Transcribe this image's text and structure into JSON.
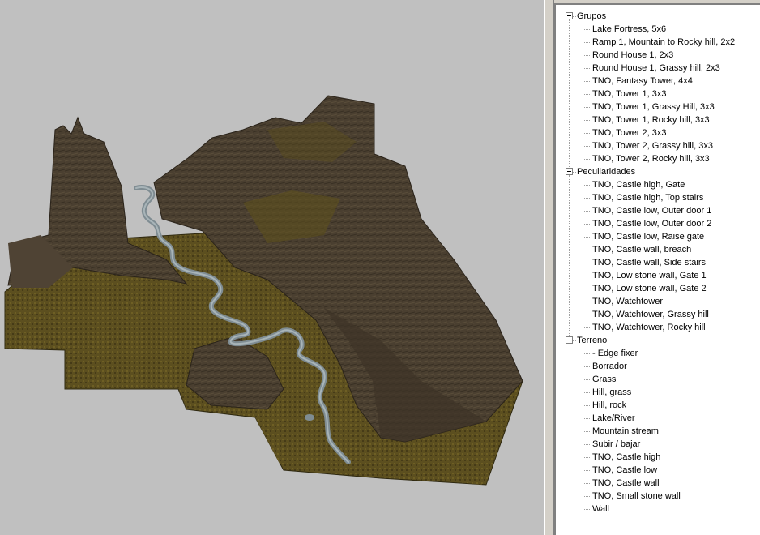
{
  "tree": {
    "groups": [
      {
        "label": "Grupos",
        "items": [
          "Lake Fortress, 5x6",
          "Ramp 1, Mountain to Rocky hill, 2x2",
          "Round House 1, 2x3",
          "Round House 1, Grassy hill, 2x3",
          "TNO, Fantasy Tower, 4x4",
          "TNO, Tower 1, 3x3",
          "TNO, Tower 1, Grassy Hill, 3x3",
          "TNO, Tower 1, Rocky hill, 3x3",
          "TNO, Tower 2, 3x3",
          "TNO, Tower 2, Grassy hill, 3x3",
          "TNO, Tower 2, Rocky hill, 3x3"
        ]
      },
      {
        "label": "Peculiaridades",
        "items": [
          "TNO, Castle high, Gate",
          "TNO, Castle high, Top stairs",
          "TNO, Castle low, Outer door 1",
          "TNO, Castle low, Outer door 2",
          "TNO, Castle low, Raise gate",
          "TNO, Castle wall, breach",
          "TNO, Castle wall, Side stairs",
          "TNO, Low stone wall, Gate 1",
          "TNO, Low stone wall, Gate 2",
          "TNO, Watchtower",
          "TNO, Watchtower, Grassy hill",
          "TNO, Watchtower, Rocky hill"
        ]
      },
      {
        "label": "Terreno",
        "items": [
          "- Edge fixer",
          "Borrador",
          "Grass",
          "Hill, grass",
          "Hill, rock",
          "Lake/River",
          "Mountain stream",
          "Subir / bajar",
          "TNO, Castle high",
          "TNO, Castle low",
          "TNO, Castle wall",
          "TNO, Small stone wall",
          "Wall"
        ]
      }
    ]
  },
  "colors": {
    "viewport_bg": "#c0c0c0",
    "panel_bg": "#d4d0c8",
    "rock": "#4a3f30",
    "grass": "#5a4e1e",
    "river": "#7f8c92"
  }
}
